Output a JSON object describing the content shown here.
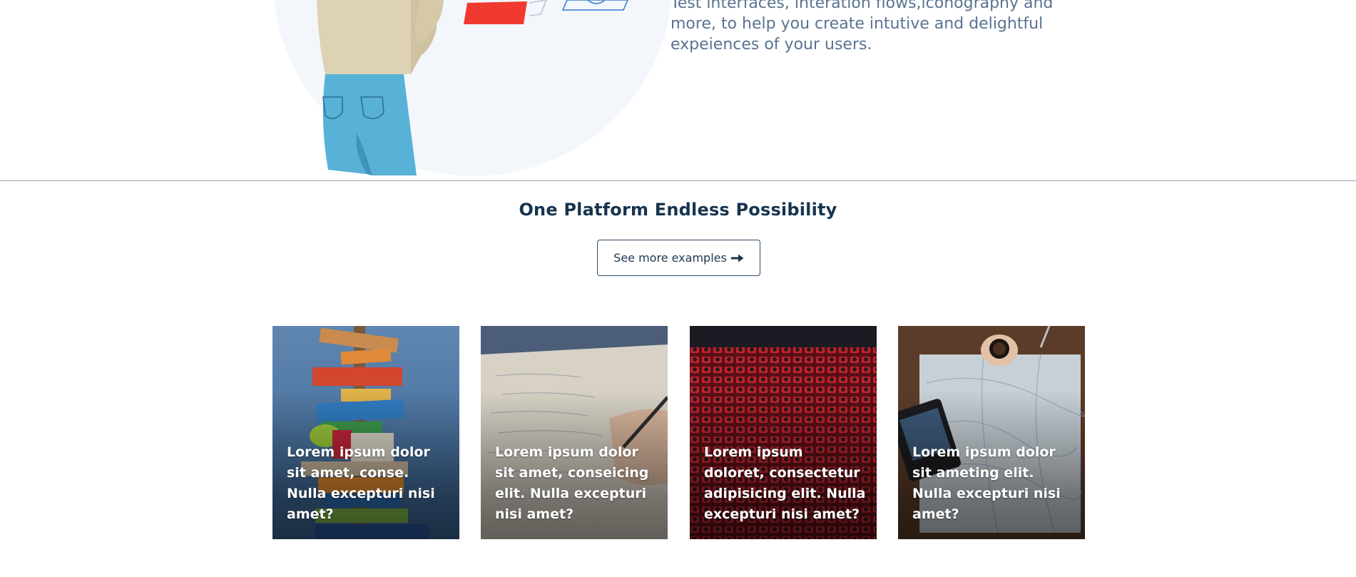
{
  "hero": {
    "text": "Test interfaces, interation flows,iconography and more, to help you create intutive and delightful expeiences of your users."
  },
  "section": {
    "title": "One Platform Endless Possibility",
    "button_label": "See more examples",
    "button_icon": "arrow-right-icon"
  },
  "cards": [
    {
      "caption": "Lorem ipsum dolor sit amet, conse. Nulla excepturi nisi amet?"
    },
    {
      "caption": "Lorem ipsum dolor sit amet, conseicing elit. Nulla excepturi nisi amet?"
    },
    {
      "caption": "Lorem ipsum doloret, consectetur adipisicing elit. Nulla excepturi nisi amet?"
    },
    {
      "caption": "Lorem ipsum dolor sit ameting elit. Nulla excepturi nisi amet?"
    }
  ],
  "colors": {
    "heading": "#17344f",
    "body_text": "#5a7392",
    "button_border": "#2b4a6b"
  }
}
